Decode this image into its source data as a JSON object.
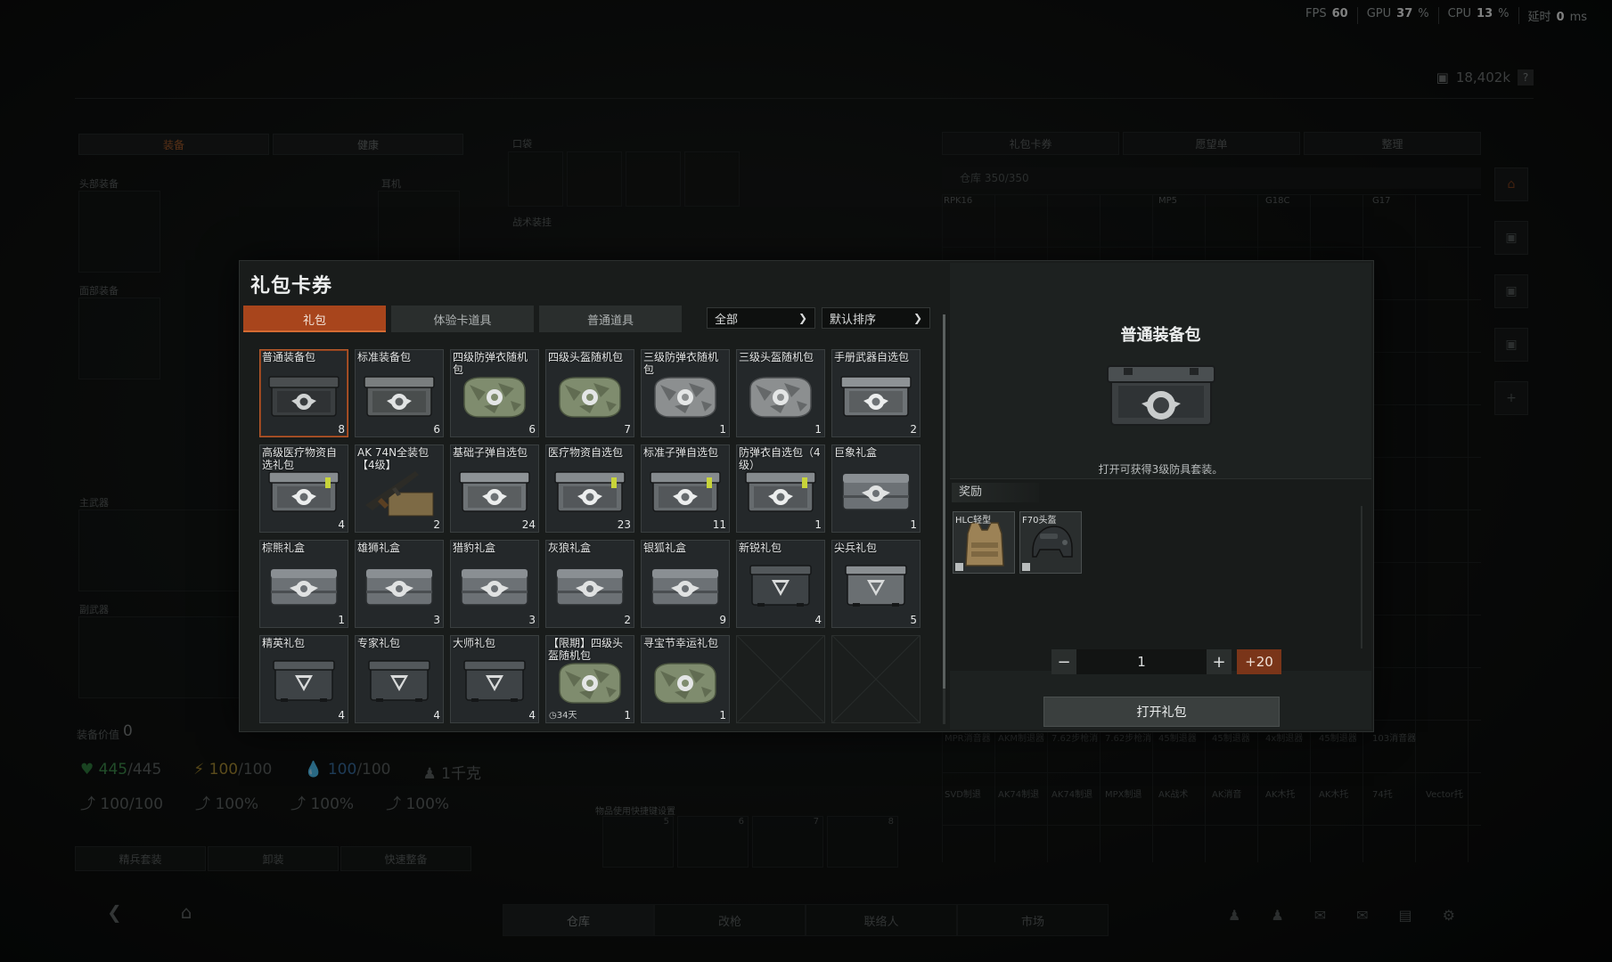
{
  "hud": {
    "fps_label": "FPS",
    "fps_value": "60",
    "gpu_label": "GPU",
    "gpu_value": "37",
    "cpu_label": "CPU",
    "cpu_value": "13",
    "latency_label": "延时",
    "latency_value": "0",
    "pct_unit": "%",
    "ms_unit": "ms",
    "currency": "18,402k",
    "help": "?"
  },
  "background": {
    "left_tabs": [
      "装备",
      "健康"
    ],
    "left_tab_num": "0",
    "slot_labels": {
      "head": "头部装备",
      "ear": "耳机",
      "face": "面部装备",
      "pocket": "口袋",
      "tactical": "战术装挂",
      "primary": "主武器",
      "secondary": "副武器"
    },
    "equip_value_label": "装备价值",
    "equip_value": "0",
    "vitals": {
      "hp": "445",
      "hp_max": "/445",
      "energy": "100",
      "energy_max": "/100",
      "water": "100",
      "water_max": "/100",
      "weight": "1千克",
      "stat1": "100/100",
      "stat2": "100%",
      "stat3": "100%",
      "stat4": "100%"
    },
    "bottom_buttons": [
      "精兵套装",
      "卸装",
      "快速整备"
    ],
    "quick_use_label": "物品使用快捷键设置",
    "quick_slots": [
      "5",
      "6",
      "7",
      "8"
    ],
    "right_tabs": [
      "礼包卡券",
      "愿望单",
      "整理"
    ],
    "warehouse_label": "仓库 350/350",
    "warehouse_items": [
      "RPK16",
      "MP5",
      "G18C",
      "G17",
      "MPR消音器",
      "AKM制退器",
      "7.62步枪消",
      "7.62步枪消",
      "45制退器",
      "45制退器",
      "4x制退器",
      "45制退器",
      "103消音器",
      "SVD制退",
      "AK74制退",
      "AK74制退",
      "MPX制退",
      "AK战术",
      "AK消音",
      "AK木托",
      "AK木托",
      "74托",
      "Vector托"
    ]
  },
  "bottom_nav": {
    "tabs": [
      "仓库",
      "改枪",
      "联络人",
      "市场"
    ]
  },
  "modal": {
    "title": "礼包卡券",
    "close": "✕",
    "tabs": [
      "礼包",
      "体验卡道具",
      "普通道具"
    ],
    "filter": "全部",
    "sort": "默认排序",
    "items": [
      {
        "name": "普通装备包",
        "count": "8",
        "icon": "crate-dark-icon"
      },
      {
        "name": "标准装备包",
        "count": "6",
        "icon": "crate-camo-icon"
      },
      {
        "name": "四级防弹衣随机包",
        "count": "6",
        "icon": "bag-green-icon"
      },
      {
        "name": "四级头盔随机包",
        "count": "7",
        "icon": "bag-green-icon"
      },
      {
        "name": "三级防弹衣随机包",
        "count": "1",
        "icon": "bag-gray-icon"
      },
      {
        "name": "三级头盔随机包",
        "count": "1",
        "icon": "bag-gray-icon"
      },
      {
        "name": "手册武器自选包",
        "count": "2",
        "icon": "crate-silver-icon"
      },
      {
        "name": "高级医疗物资自选礼包",
        "count": "4",
        "icon": "crate-green-tag-icon"
      },
      {
        "name": "AK 74N全装包【4级】",
        "count": "2",
        "icon": "rifle-icon"
      },
      {
        "name": "基础子弹自选包",
        "count": "24",
        "icon": "crate-silver-icon"
      },
      {
        "name": "医疗物资自选包",
        "count": "23",
        "icon": "crate-green-tag-icon"
      },
      {
        "name": "标准子弹自选包",
        "count": "11",
        "icon": "crate-green-tag-icon"
      },
      {
        "name": "防弹衣自选包（4级）",
        "count": "1",
        "icon": "crate-green-tag-icon"
      },
      {
        "name": "巨象礼盒",
        "count": "1",
        "icon": "box-silver-icon"
      },
      {
        "name": "棕熊礼盒",
        "count": "1",
        "icon": "box-silver-icon"
      },
      {
        "name": "雄狮礼盒",
        "count": "3",
        "icon": "box-silver-icon"
      },
      {
        "name": "猎豹礼盒",
        "count": "3",
        "icon": "box-silver-icon"
      },
      {
        "name": "灰狼礼盒",
        "count": "2",
        "icon": "box-silver-icon"
      },
      {
        "name": "银狐礼盒",
        "count": "9",
        "icon": "box-silver-icon"
      },
      {
        "name": "新锐礼包",
        "count": "4",
        "icon": "case-dark-icon"
      },
      {
        "name": "尖兵礼包",
        "count": "5",
        "icon": "case-silver-icon"
      },
      {
        "name": "精英礼包",
        "count": "4",
        "icon": "case-dark-icon"
      },
      {
        "name": "专家礼包",
        "count": "4",
        "icon": "case-dark-icon"
      },
      {
        "name": "大师礼包",
        "count": "4",
        "icon": "case-dark-icon"
      },
      {
        "name": "【限期】四级头盔随机包",
        "count": "1",
        "timer": "34天",
        "icon": "bag-green-icon"
      },
      {
        "name": "寻宝节幸运礼包",
        "count": "1",
        "icon": "bag-green-icon"
      }
    ],
    "empty_slots": 2,
    "detail": {
      "title": "普通装备包",
      "description": "打开可获得3级防具套装。",
      "reward_label": "奖励",
      "rewards": [
        {
          "name": "HLC轻型",
          "icon": "vest-icon"
        },
        {
          "name": "F70头盔",
          "icon": "helmet-icon"
        }
      ],
      "quantity": "1",
      "minus": "−",
      "plus": "+",
      "max_label": "+20",
      "open_label": "打开礼包"
    }
  },
  "colors": {
    "accent": "#a8451c",
    "panel": "#191c1b",
    "cell": "#24282a"
  }
}
